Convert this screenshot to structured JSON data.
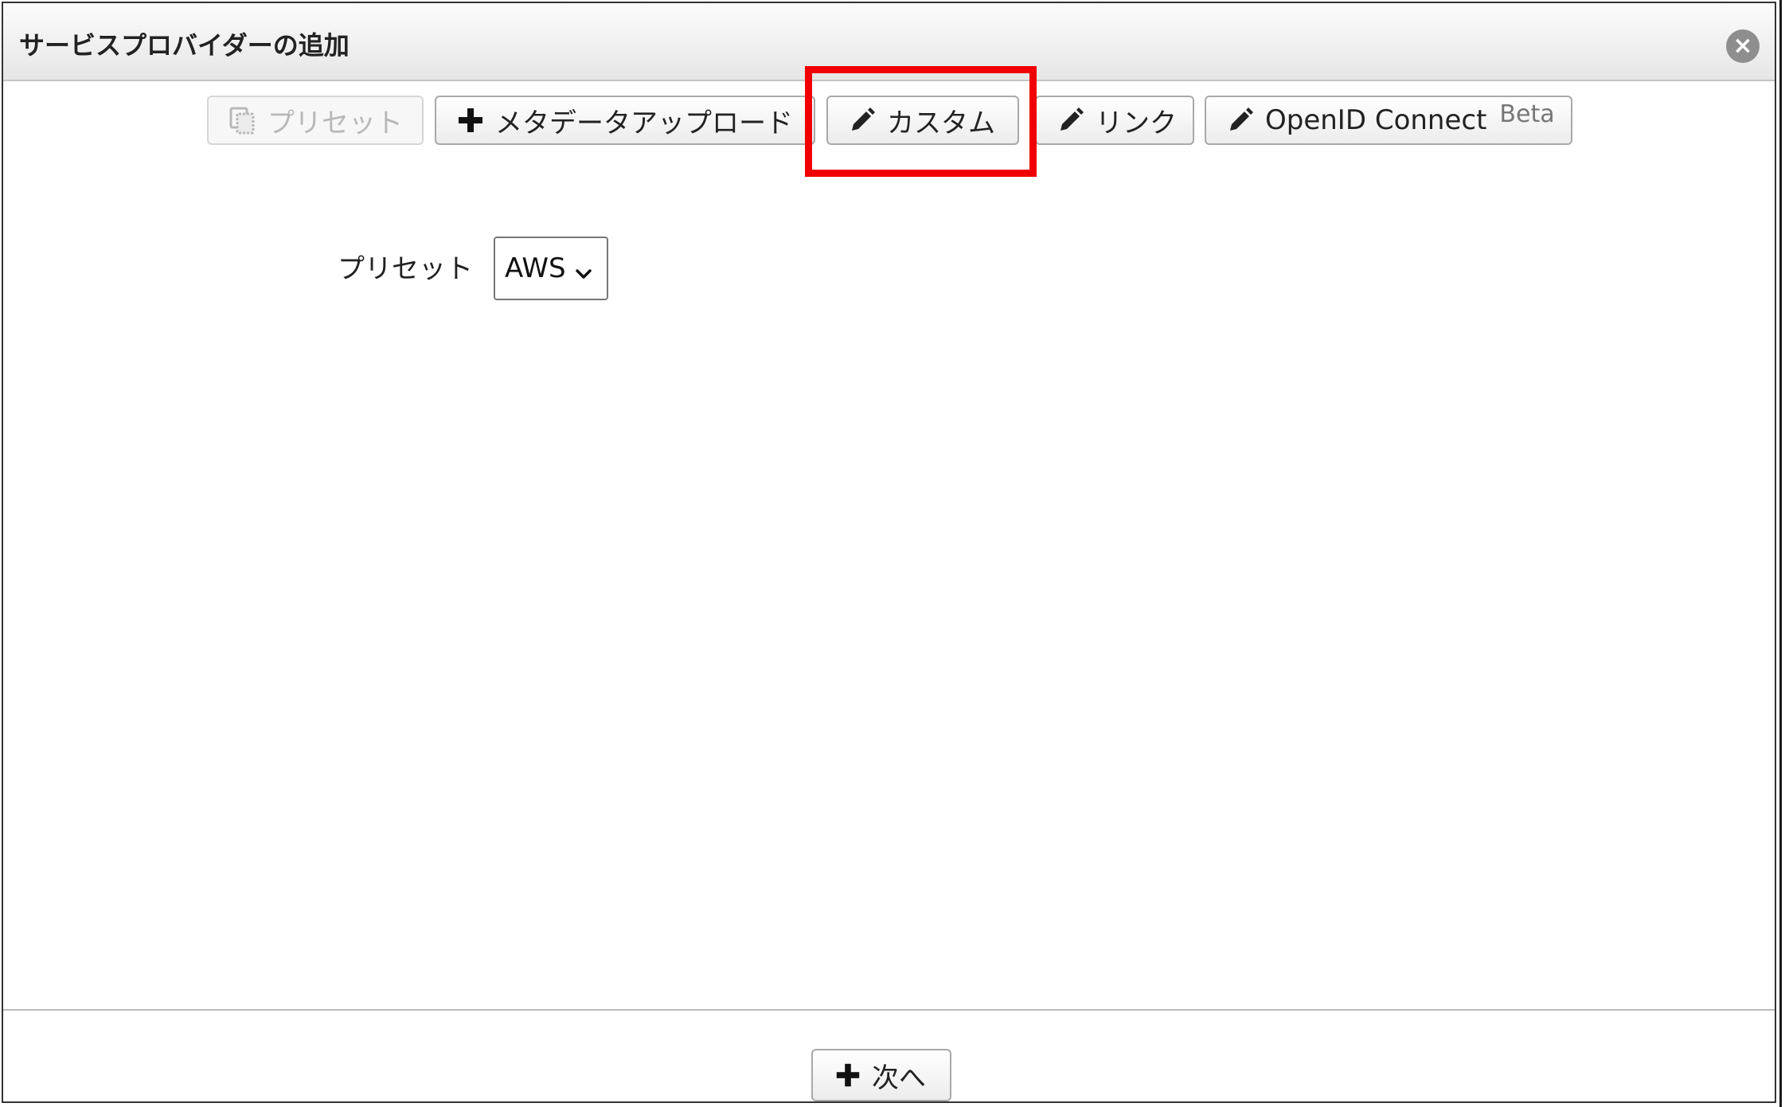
{
  "dialog": {
    "title": "サービスプロバイダーの追加",
    "close_icon": "close-icon"
  },
  "tabs": [
    {
      "label": "プリセット",
      "icon": "copy-icon",
      "disabled": true
    },
    {
      "label": "メタデータアップロード",
      "icon": "plus-icon",
      "disabled": false
    },
    {
      "label": "カスタム",
      "icon": "pencil-icon",
      "disabled": false,
      "highlighted": true
    },
    {
      "label": "リンク",
      "icon": "pencil-icon",
      "disabled": false
    },
    {
      "label": "OpenID Connect",
      "badge": "Beta",
      "icon": "pencil-icon",
      "disabled": false
    }
  ],
  "form": {
    "preset_label": "プリセット",
    "preset_value": "AWS"
  },
  "footer": {
    "next_label": "次へ",
    "next_icon": "plus-icon"
  },
  "colors": {
    "highlight": "#f00000",
    "border": "#a9a9a9"
  }
}
